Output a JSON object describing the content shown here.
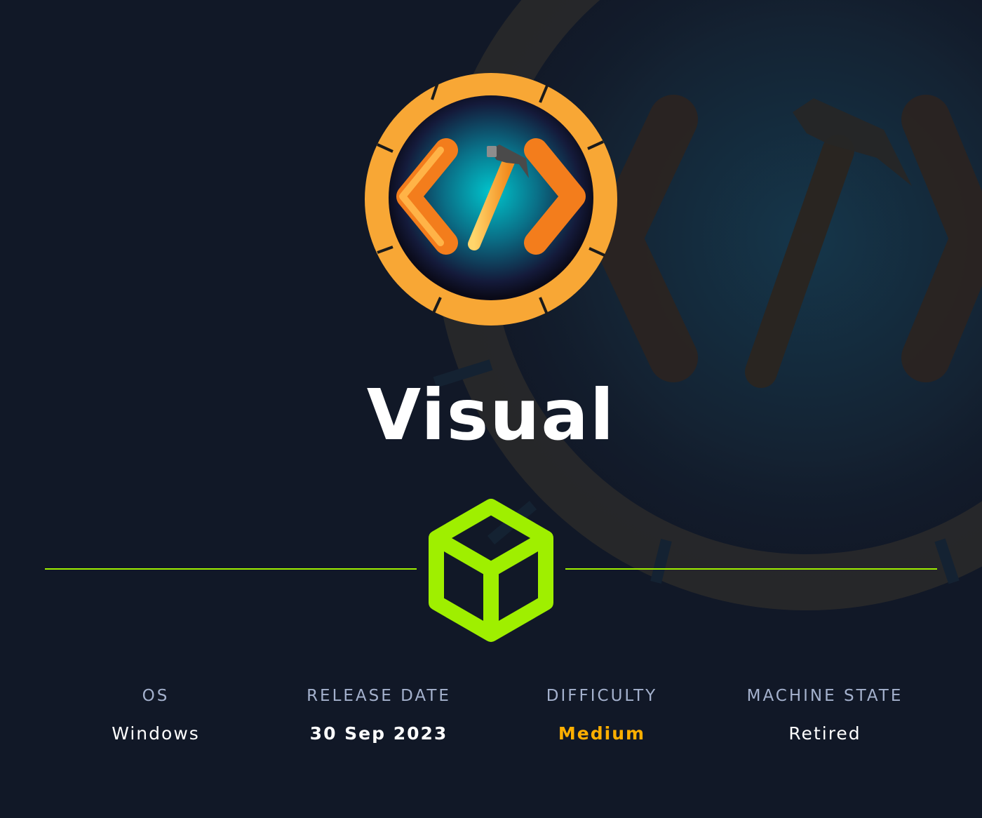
{
  "machine": {
    "name": "Visual"
  },
  "info": {
    "os": {
      "label": "OS",
      "value": "Windows"
    },
    "release_date": {
      "label": "RELEASE DATE",
      "value": "30 Sep 2023"
    },
    "difficulty": {
      "label": "DIFFICULTY",
      "value": "Medium"
    },
    "machine_state": {
      "label": "MACHINE STATE",
      "value": "Retired"
    }
  },
  "colors": {
    "background": "#111827",
    "accent_green": "#9fef00",
    "difficulty_medium": "#ffaf00",
    "badge_orange": "#f8a735",
    "label_gray": "#a4b1cd"
  },
  "icons": {
    "logo": "code-hammer-badge-icon",
    "divider": "cube-icon"
  }
}
